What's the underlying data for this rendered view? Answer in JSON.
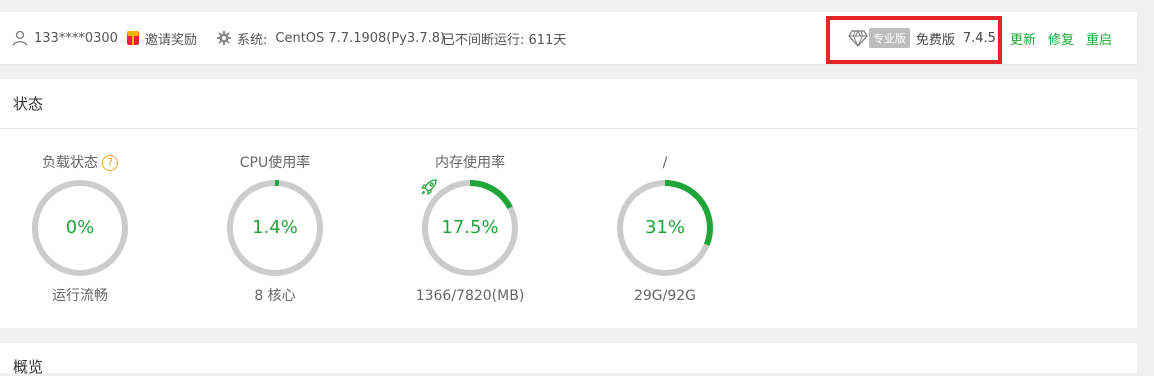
{
  "header": {
    "user": "133****0300",
    "invite_label": "邀请奖励",
    "system_label": "系统:",
    "system_value": "CentOS 7.7.1908(Py3.7.8)",
    "uptime": "已不间断运行: 611天",
    "pro_tag": "专业版",
    "edition": "免费版",
    "version": "7.4.5",
    "update_label": "更新",
    "repair_label": "修复",
    "restart_label": "重启",
    "accent_color": "#20a53a",
    "highlight_color": "#e8242a"
  },
  "status": {
    "title": "状态",
    "gauges": [
      {
        "title": "负载状态",
        "value": "0%",
        "percent": 0,
        "sub": "运行流畅",
        "help": "?"
      },
      {
        "title": "CPU使用率",
        "value": "1.4%",
        "percent": 1.4,
        "sub": "8 核心"
      },
      {
        "title": "内存使用率",
        "value": "17.5%",
        "percent": 17.5,
        "sub": "1366/7820(MB)"
      },
      {
        "title": "/",
        "value": "31%",
        "percent": 31,
        "sub": "29G/92G"
      }
    ]
  },
  "overview": {
    "title": "概览"
  }
}
